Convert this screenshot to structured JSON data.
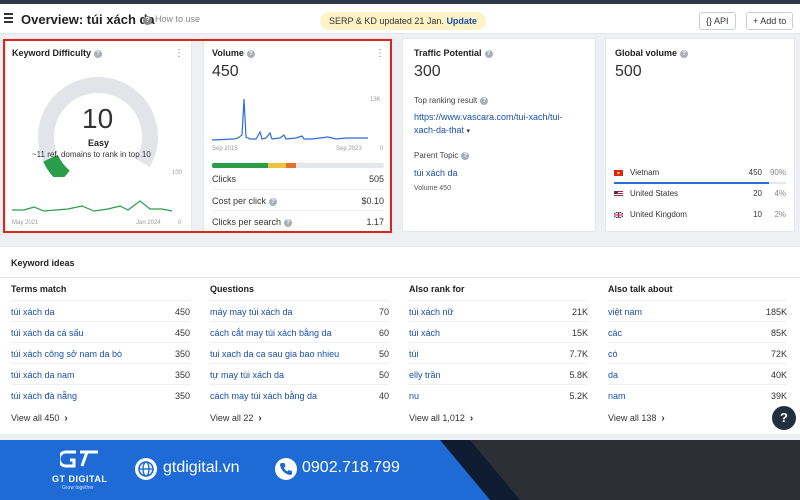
{
  "header": {
    "title": "Overview: túi xách da",
    "how_to_use": "How to use",
    "banner_text": "SERP & KD updated 21 Jan.",
    "banner_link": "Update",
    "api_label": "{} API",
    "add_to_label": "+ Add to"
  },
  "keyword_difficulty": {
    "title": "Keyword Difficulty",
    "value": "10",
    "level": "Easy",
    "note": "~11 ref. domains to rank in top 10",
    "chart_max": "100",
    "chart_min": "0",
    "date_start": "May 2021",
    "date_end": "Jan 2024",
    "gauge_color": "#2a9d4b"
  },
  "volume": {
    "title": "Volume",
    "value": "450",
    "chart_max": "13K",
    "chart_min": "0",
    "date_start": "Sep 2015",
    "date_end": "Sep 2023",
    "metrics": [
      {
        "label": "Clicks",
        "value": "505"
      },
      {
        "label": "Cost per click",
        "value": "$0.10"
      },
      {
        "label": "Clicks per search",
        "value": "1.17"
      }
    ]
  },
  "traffic_potential": {
    "title": "Traffic Potential",
    "value": "300",
    "top_result_label": "Top ranking result",
    "top_result_url": "https://www.vascara.com/tui-xach/tui-xach-da-that",
    "parent_topic_label": "Parent Topic",
    "parent_topic": "túi xách da",
    "parent_volume": "Volume 450"
  },
  "global_volume": {
    "title": "Global volume",
    "value": "500",
    "countries": [
      {
        "name": "Vietnam",
        "value": "450",
        "pct": "90%"
      },
      {
        "name": "United States",
        "value": "20",
        "pct": "4%"
      },
      {
        "name": "United Kingdom",
        "value": "10",
        "pct": "2%"
      }
    ]
  },
  "ideas": {
    "title": "Keyword ideas",
    "columns": [
      {
        "title": "Terms match",
        "rows": [
          {
            "k": "túi xách da",
            "v": "450"
          },
          {
            "k": "túi xách da cá sấu",
            "v": "450"
          },
          {
            "k": "túi xách công sở nam da bò",
            "v": "350"
          },
          {
            "k": "túi xách da nam",
            "v": "350"
          },
          {
            "k": "túi xách đà nẵng",
            "v": "350"
          }
        ],
        "view_all": "View all 450"
      },
      {
        "title": "Questions",
        "rows": [
          {
            "k": "máy may túi xách da",
            "v": "70"
          },
          {
            "k": "cách cắt may túi xách bằng da",
            "v": "60"
          },
          {
            "k": "tui xach da ca sau gia bao nhieu",
            "v": "50"
          },
          {
            "k": "tự may túi xách da",
            "v": "50"
          },
          {
            "k": "cách may túi xách bằng da",
            "v": "40"
          }
        ],
        "view_all": "View all 22"
      },
      {
        "title": "Also rank for",
        "rows": [
          {
            "k": "túi xách nữ",
            "v": "21K"
          },
          {
            "k": "túi xách",
            "v": "15K"
          },
          {
            "k": "túi",
            "v": "7.7K"
          },
          {
            "k": "elly trần",
            "v": "5.8K"
          },
          {
            "k": "nu",
            "v": "5.2K"
          }
        ],
        "view_all": "View all 1,012"
      },
      {
        "title": "Also talk about",
        "rows": [
          {
            "k": "việt nam",
            "v": "185K"
          },
          {
            "k": "các",
            "v": "85K"
          },
          {
            "k": "có",
            "v": "72K"
          },
          {
            "k": "da",
            "v": "40K"
          },
          {
            "k": "nam",
            "v": "39K"
          }
        ],
        "view_all": "View all 138"
      }
    ]
  },
  "footer": {
    "brand": "GT DIGITAL",
    "tagline": "Grow together",
    "website": "gtdigital.vn",
    "phone": "0902.718.799"
  }
}
